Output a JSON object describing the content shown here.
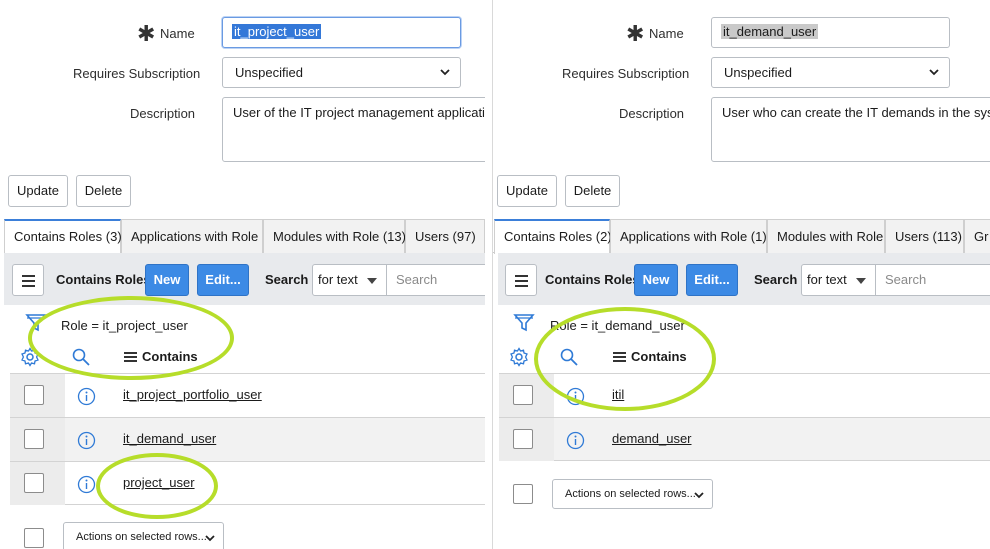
{
  "left": {
    "form": {
      "name_label": "Name",
      "name_value": "it_project_user",
      "subscription_label": "Requires Subscription",
      "subscription_value": "Unspecified",
      "description_label": "Description",
      "description_value": "User of the IT project management application"
    },
    "buttons": {
      "update": "Update",
      "delete": "Delete"
    },
    "tabs": [
      "Contains Roles (3)",
      "Applications with Role",
      "Modules with Role (13)",
      "Users (97)"
    ],
    "list": {
      "title": "Contains Roles",
      "new_label": "New",
      "edit_label": "Edit...",
      "search_label": "Search",
      "search_mode": "for text",
      "search_placeholder": "Search",
      "filter": "Role = it_project_user",
      "column_header": "Contains",
      "rows": [
        "it_project_portfolio_user",
        "it_demand_user",
        "project_user"
      ],
      "actions": "Actions on selected rows..."
    }
  },
  "right": {
    "form": {
      "name_label": "Name",
      "name_value": "it_demand_user",
      "subscription_label": "Requires Subscription",
      "subscription_value": "Unspecified",
      "description_label": "Description",
      "description_value": "User who can  create the IT demands in the system"
    },
    "buttons": {
      "update": "Update",
      "delete": "Delete"
    },
    "tabs": [
      "Contains Roles (2)",
      "Applications with Role (1)",
      "Modules with Role",
      "Users (113)",
      "Gr"
    ],
    "list": {
      "title": "Contains Roles",
      "new_label": "New",
      "edit_label": "Edit...",
      "search_label": "Search",
      "search_mode": "for text",
      "search_placeholder": "Search",
      "filter": "Role = it_demand_user",
      "column_header": "Contains",
      "rows": [
        "itil",
        "demand_user"
      ],
      "actions": "Actions on selected rows..."
    }
  },
  "colors": {
    "primary": "#3c8ae5",
    "highlight": "#b6dd2a",
    "selection": "#3478d8"
  }
}
